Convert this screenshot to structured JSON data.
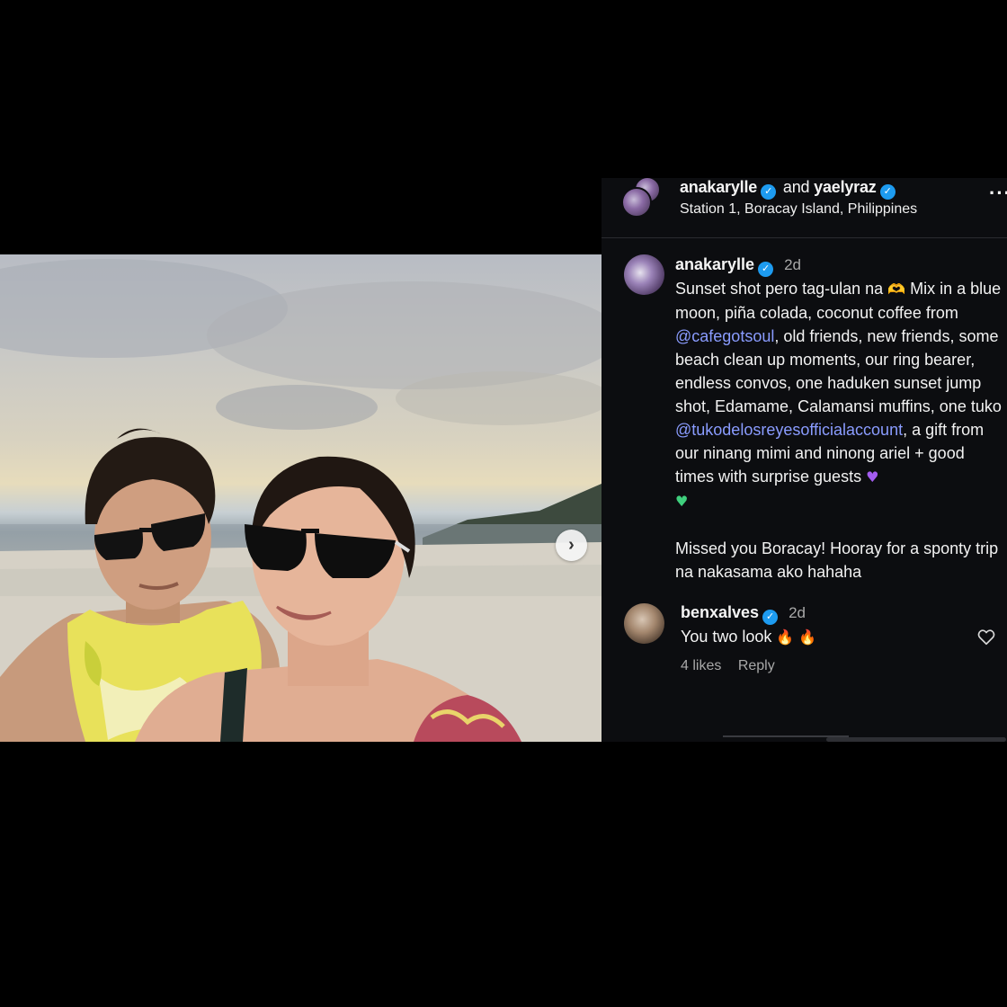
{
  "post": {
    "header": {
      "author1": "anakarylle",
      "and_label": "and",
      "author2": "yaelyraz",
      "location": "Station 1, Boracay Island, Philippines",
      "more_icon": "more-horizontal-icon"
    },
    "photo": {
      "next_icon": "chevron-right-icon",
      "next_glyph": "›"
    },
    "caption": {
      "username": "anakarylle",
      "time": "2d",
      "text_1": "Sunset shot pero tag-ulan na ",
      "emoji_hands": "🫶",
      "text_2": " Mix in a blue moon, piña colada, coconut coffee from ",
      "mention_1": "@cafegotsoul",
      "text_3": ", old friends, new friends, some beach clean up moments, our ring bearer, endless convos, one haduken sunset jump shot, Edamame, Calamansi muffins, one tuko ",
      "mention_2": "@tukodelosreyesofficialaccount",
      "text_4": ", a gift from our ninang mimi and ninong ariel + good times with surprise guests ",
      "emoji_purple_heart": "♥",
      "emoji_green_heart": "♥",
      "text_5": "Missed you Boracay! Hooray for a sponty trip na nakasama ako hahaha"
    },
    "comments": [
      {
        "username": "benxalves",
        "time": "2d",
        "text": "You two look ",
        "emoji_fire": "🔥 🔥",
        "likes": "4 likes",
        "reply_label": "Reply",
        "like_icon": "heart-outline-icon"
      }
    ],
    "colors": {
      "panel_bg": "#0c0d10",
      "verified": "#1d9bf0",
      "mention": "#8a9cff"
    }
  }
}
